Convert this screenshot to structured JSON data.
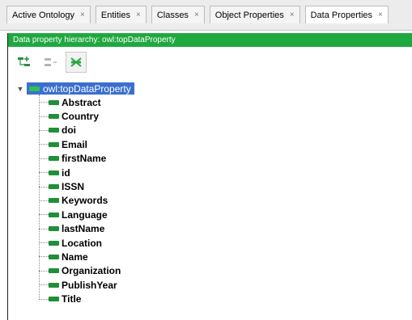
{
  "tabs": [
    {
      "label": "Active Ontology",
      "active": false
    },
    {
      "label": "Entities",
      "active": false
    },
    {
      "label": "Classes",
      "active": false
    },
    {
      "label": "Object Properties",
      "active": false
    },
    {
      "label": "Data Properties",
      "active": true
    }
  ],
  "tab_close_glyph": "×",
  "header": {
    "title": "Data property hierarchy: owl:topDataProperty"
  },
  "toolbar": {
    "buttons": [
      {
        "name": "add-subproperty-icon"
      },
      {
        "name": "add-sibling-property-icon"
      },
      {
        "name": "delete-property-icon"
      }
    ]
  },
  "tree": {
    "root": {
      "label": "owl:topDataProperty",
      "expanded": true
    },
    "children": [
      "Abstract",
      "Country",
      "doi",
      "Email",
      "firstName",
      "id",
      "ISSN",
      "Keywords",
      "Language",
      "lastName",
      "Location",
      "Name",
      "Organization",
      "PublishYear",
      "Title"
    ]
  },
  "colors": {
    "header_bg": "#1fa83f",
    "selection_bg": "#3a6fd0",
    "property_icon": "#1f8f3a"
  }
}
